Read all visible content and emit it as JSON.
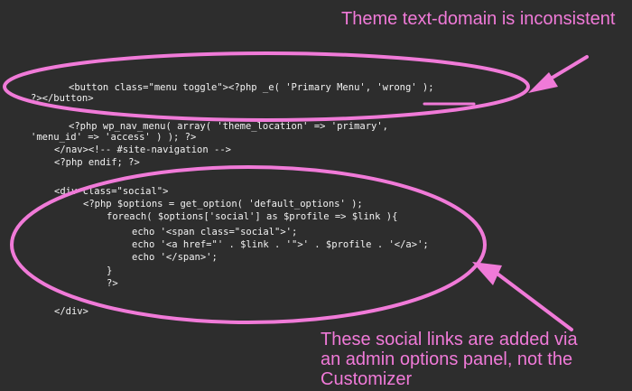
{
  "annotations": {
    "top_callout": "Theme text-domain is inconsistent",
    "bottom_callout": [
      "These social links are added via",
      "an admin options panel, not the",
      "Customizer"
    ],
    "accent_color": "#f07ad8"
  },
  "code": {
    "lines": [
      "<button class=\"menu toggle\"><?php _e( 'Primary Menu', 'wrong' );",
      "?></button>",
      "<?php wp_nav_menu( array( 'theme_location' => 'primary',",
      "'menu_id' => 'access' ) ); ?>",
      "</nav><!-- #site-navigation -->",
      "<?php endif; ?>",
      "<div class=\"social\">",
      "<?php $options = get_option( 'default_options' );",
      "foreach( $options['social'] as $profile => $link ){",
      "echo '<span class=\"social\">';",
      "echo '<a href=\"' . $link . '\">' . $profile . '</a>';",
      "echo '</span>';",
      "}",
      "?>",
      "</div>"
    ]
  }
}
